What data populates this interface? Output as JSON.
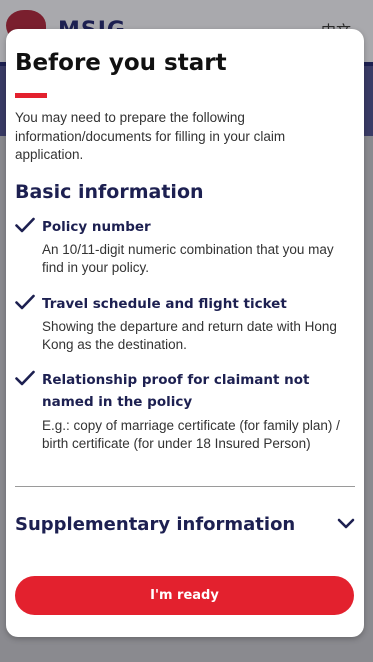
{
  "background": {
    "logo_text": "MSIG",
    "language_link": "中文"
  },
  "modal": {
    "title": "Before you start",
    "intro": "You may need to prepare the following information/documents for filling in your claim application.",
    "basic_section_title": "Basic information",
    "items": [
      {
        "title": "Policy number",
        "description": "An 10/11-digit numeric combination that you may find in your policy."
      },
      {
        "title": "Travel schedule and flight ticket",
        "description": "Showing the departure and return date with Hong Kong as the destination."
      },
      {
        "title": "Relationship proof for claimant not named in the policy",
        "description": "E.g.: copy of marriage certificate (for family plan) / birth certificate (for under 18 Insured Person)"
      }
    ],
    "supplementary_title": "Supplementary information",
    "ready_button": "I'm ready"
  },
  "colors": {
    "navy": "#1d2051",
    "accent_red": "#e3212e"
  },
  "icons": {
    "check": "check-icon",
    "chevron": "chevron-down-icon"
  }
}
